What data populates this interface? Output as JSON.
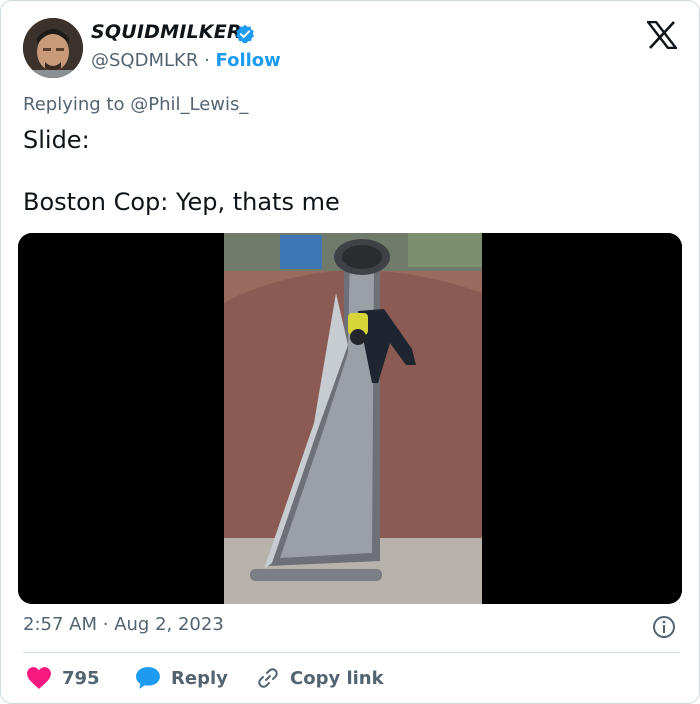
{
  "author": {
    "name": "SQUIDMILKER",
    "handle": "@SQDMLKR",
    "separator": "·",
    "follow_label": "Follow"
  },
  "reply_prefix": "Replying to",
  "reply_mention": "@Phil_Lewis_",
  "tweet_text": "Slide:\n\nBoston Cop: Yep, thats me",
  "timestamp": {
    "time": "2:57 AM",
    "separator": "·",
    "date": "Aug 2, 2023"
  },
  "actions": {
    "like_count": "795",
    "reply_label": "Reply",
    "copy_label": "Copy link"
  },
  "colors": {
    "accent": "#1d9bf0",
    "like": "#f91880",
    "muted": "#536471"
  },
  "icons": [
    "verified-badge-icon",
    "x-logo-icon",
    "info-icon",
    "heart-icon",
    "reply-bubble-icon",
    "link-icon"
  ]
}
